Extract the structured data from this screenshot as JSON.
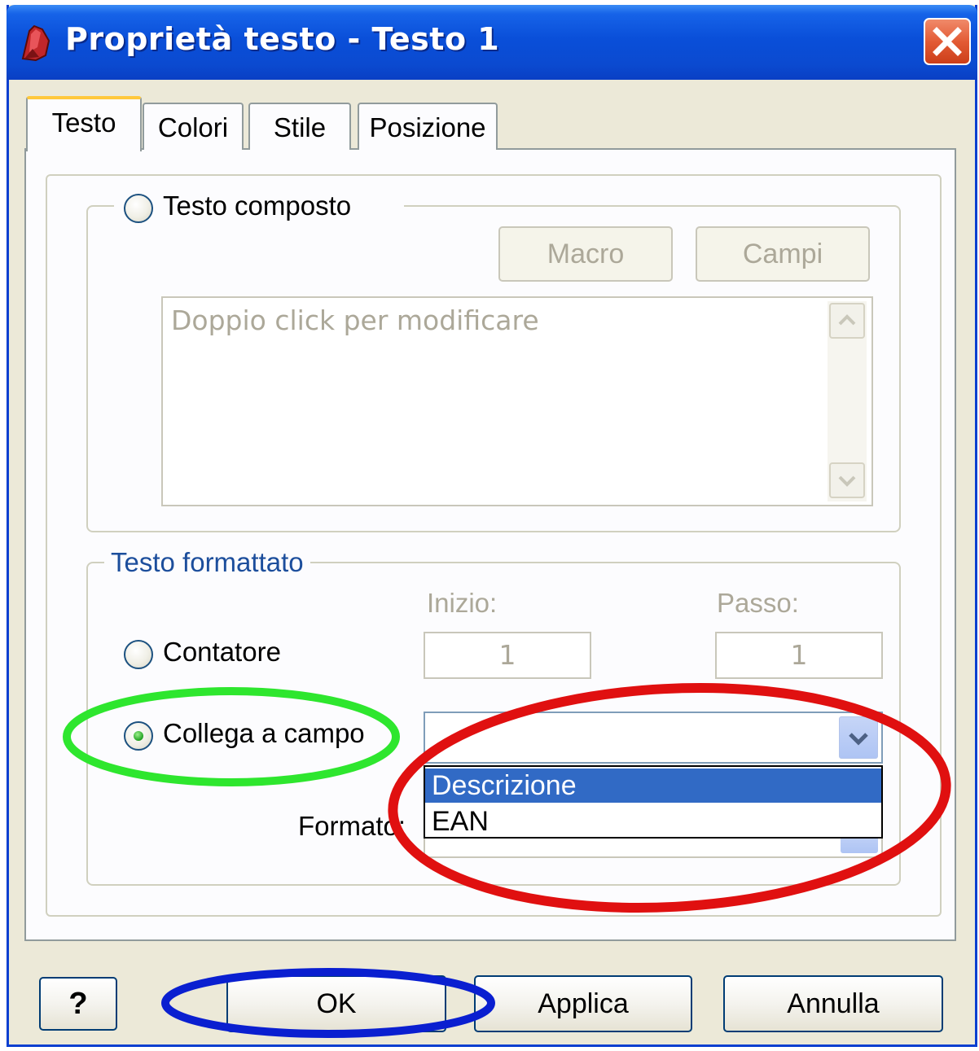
{
  "window": {
    "title": "Proprietà testo - Testo 1"
  },
  "tabs": [
    {
      "label": "Testo",
      "selected": true
    },
    {
      "label": "Colori",
      "selected": false
    },
    {
      "label": "Stile",
      "selected": false
    },
    {
      "label": "Posizione",
      "selected": false
    }
  ],
  "testo_composto": {
    "label": "Testo composto",
    "selected": false,
    "macro_label": "Macro",
    "campi_label": "Campi",
    "placeholder": "Doppio click per modificare"
  },
  "testo_formattato": {
    "legend": "Testo formattato",
    "inizio_label": "Inizio:",
    "passo_label": "Passo:",
    "contatore_label": "Contatore",
    "contatore_selected": false,
    "inizio_value": "1",
    "passo_value": "1",
    "collega_label": "Collega a campo",
    "collega_selected": true,
    "formato_label": "Formato:",
    "dropdown_options": [
      "Descrizione",
      "EAN"
    ],
    "highlighted_option": "Descrizione"
  },
  "buttons": {
    "help_label": "?",
    "ok_label": "OK",
    "applica_label": "Applica",
    "annulla_label": "Annulla"
  },
  "annotation_colors": {
    "green": "#2ee62e",
    "red": "#e01010",
    "blue": "#0a1fd0"
  },
  "colors": {
    "title_bar": "#0a4fd9",
    "dialog_bg": "#ece9d8",
    "selection": "#316ac5"
  }
}
